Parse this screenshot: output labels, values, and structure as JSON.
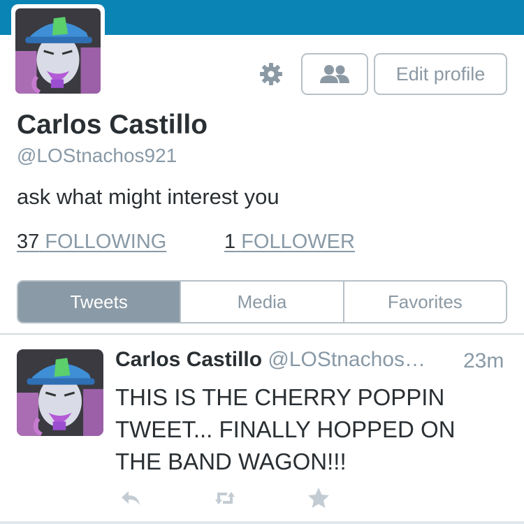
{
  "profile": {
    "name": "Carlos Castillo",
    "handle": "@LOStnachos921",
    "bio": "ask what might interest you",
    "following_count": "37",
    "following_label": "FOLLOWING",
    "followers_count": "1",
    "followers_label": "FOLLOWER"
  },
  "actions": {
    "settings_icon": "gear-icon",
    "follow_icon": "people-icon",
    "edit_label": "Edit profile"
  },
  "tabs": [
    {
      "label": "Tweets",
      "active": true
    },
    {
      "label": "Media",
      "active": false
    },
    {
      "label": "Favorites",
      "active": false
    }
  ],
  "tweet": {
    "name": "Carlos Castillo",
    "handle": "@LOStnachos…",
    "time": "23m",
    "text": "THIS IS THE CHERRY POPPIN TWEET... FINALLY HOPPED ON THE BAND WAGON!!!",
    "actions": [
      "reply-icon",
      "retweet-icon",
      "favorite-icon"
    ]
  },
  "colors": {
    "header": "#0a84b4",
    "muted": "#8899a6",
    "text": "#292f33",
    "tab_active": "#8a9aa6"
  }
}
